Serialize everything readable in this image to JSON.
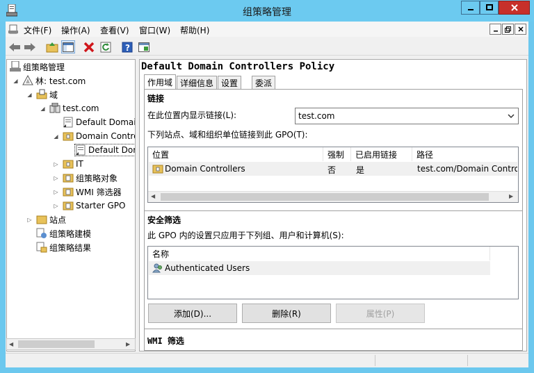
{
  "window": {
    "title": "组策略管理"
  },
  "menu": [
    "文件(F)",
    "操作(A)",
    "查看(V)",
    "窗口(W)",
    "帮助(H)"
  ],
  "tree": {
    "root": "组策略管理",
    "forest": "林: test.com",
    "domains": "域",
    "domain": "test.com",
    "default_domain": "Default Domai",
    "dc_ou": "Domain Contro",
    "default_dc": "Default Dor",
    "it": "IT",
    "gpo_objects": "组策略对象",
    "wmi_filters": "WMI 筛选器",
    "starter_gpo": "Starter GPO",
    "sites": "站点",
    "modeling": "组策略建模",
    "results": "组策略结果"
  },
  "gpo": {
    "title": "Default Domain Controllers Policy"
  },
  "tabs": [
    "作用域",
    "详细信息",
    "设置",
    "委派"
  ],
  "links": {
    "heading": "链接",
    "display_label": "在此位置内显示链接(L):",
    "location_value": "test.com",
    "desc": "下列站点、域和组织单位链接到此 GPO(T):",
    "columns": [
      "位置",
      "强制",
      "已启用链接",
      "路径"
    ],
    "rows": [
      {
        "location": "Domain Controllers",
        "enforced": "否",
        "enabled": "是",
        "path": "test.com/Domain Control"
      }
    ]
  },
  "security": {
    "heading": "安全筛选",
    "desc": "此 GPO 内的设置只应用于下列组、用户和计算机(S):",
    "column": "名称",
    "items": [
      "Authenticated Users"
    ],
    "add_label": "添加(D)...",
    "remove_label": "删除(R)",
    "props_label": "属性(P)"
  },
  "wmi": {
    "heading": "WMI 筛选"
  },
  "colors": {
    "titlebar": "#6ccaf0",
    "close": "#c7302a",
    "selection": "#cce8ff"
  }
}
